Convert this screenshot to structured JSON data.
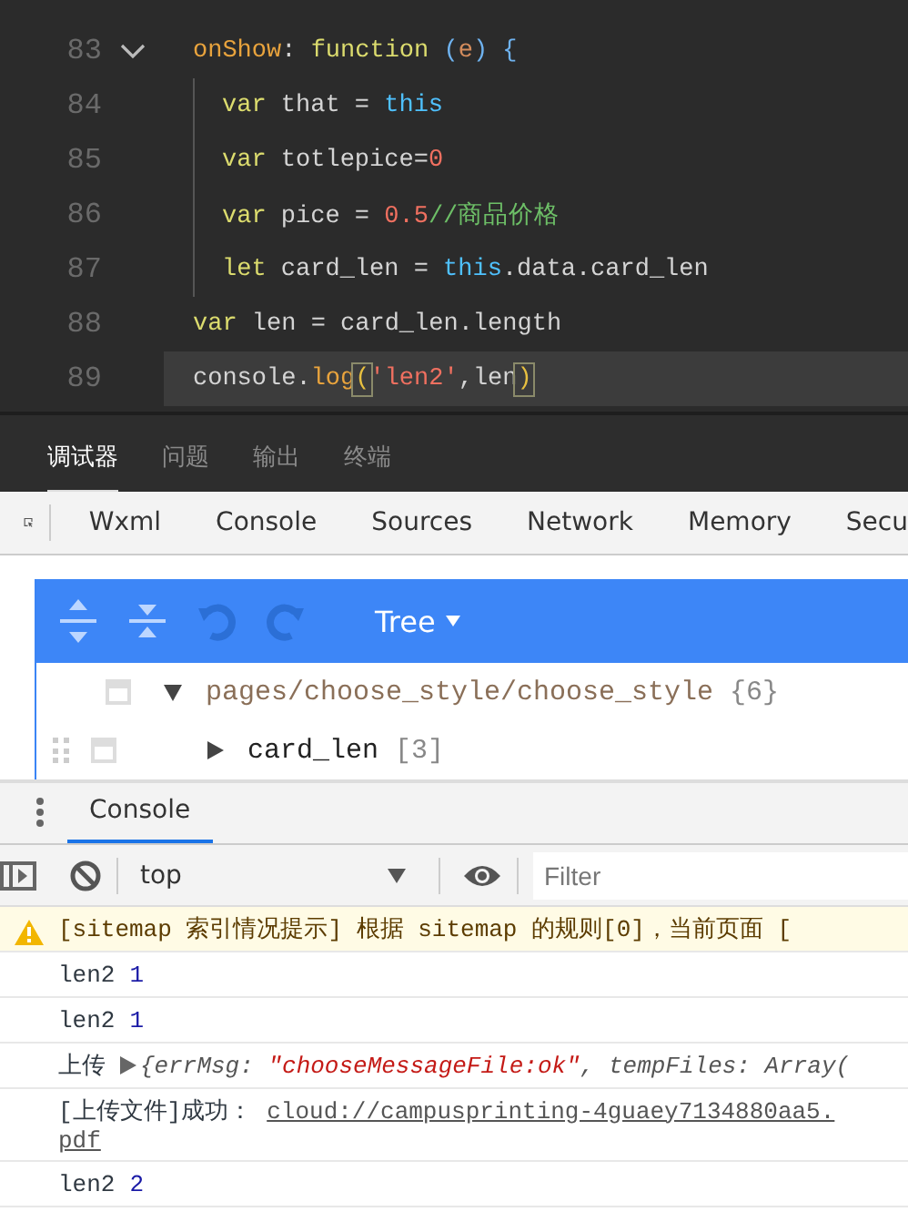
{
  "editor": {
    "lines": [
      {
        "number": "83",
        "foldable": true,
        "current": false,
        "guide": false,
        "tokens": [
          {
            "text": "onShow",
            "kind": "prop"
          },
          {
            "text": ": ",
            "kind": "plain"
          },
          {
            "text": "function",
            "kind": "keyword"
          },
          {
            "text": " (",
            "kind": "paren"
          },
          {
            "text": "e",
            "kind": "param"
          },
          {
            "text": ")",
            "kind": "paren"
          },
          {
            "text": " {",
            "kind": "paren"
          }
        ]
      },
      {
        "number": "84",
        "foldable": false,
        "current": false,
        "guide": true,
        "tokens": [
          {
            "text": "var",
            "kind": "keyword"
          },
          {
            "text": " that = ",
            "kind": "plain"
          },
          {
            "text": "this",
            "kind": "this"
          }
        ]
      },
      {
        "number": "85",
        "foldable": false,
        "current": false,
        "guide": true,
        "tokens": [
          {
            "text": "var",
            "kind": "keyword"
          },
          {
            "text": " totlepice=",
            "kind": "plain"
          },
          {
            "text": "0",
            "kind": "number"
          }
        ]
      },
      {
        "number": "86",
        "foldable": false,
        "current": false,
        "guide": true,
        "tokens": [
          {
            "text": "var",
            "kind": "keyword"
          },
          {
            "text": " pice = ",
            "kind": "plain"
          },
          {
            "text": "0.5",
            "kind": "number"
          },
          {
            "text": "//商品价格",
            "kind": "comment"
          }
        ]
      },
      {
        "number": "87",
        "foldable": false,
        "current": false,
        "guide": true,
        "tokens": [
          {
            "text": "let",
            "kind": "keyword"
          },
          {
            "text": " card_len = ",
            "kind": "plain"
          },
          {
            "text": "this",
            "kind": "this"
          },
          {
            "text": ".data.card_len",
            "kind": "plain"
          }
        ]
      },
      {
        "number": "88",
        "foldable": false,
        "current": false,
        "guide": false,
        "tokens": [
          {
            "text": "var",
            "kind": "keyword"
          },
          {
            "text": " len = card_len.length",
            "kind": "plain"
          }
        ]
      },
      {
        "number": "89",
        "foldable": false,
        "current": true,
        "guide": false,
        "tokens": [
          {
            "text": "console.",
            "kind": "plain"
          },
          {
            "text": "log",
            "kind": "prop"
          },
          {
            "text": "(",
            "kind": "match"
          },
          {
            "text": "'len2'",
            "kind": "number"
          },
          {
            "text": ",len",
            "kind": "plain"
          },
          {
            "text": ")",
            "kind": "match"
          }
        ]
      }
    ]
  },
  "bottom_tabs": [
    {
      "label": "调试器",
      "selected": true
    },
    {
      "label": "问题",
      "selected": false
    },
    {
      "label": "输出",
      "selected": false
    },
    {
      "label": "终端",
      "selected": false
    }
  ],
  "devtools_tabs": [
    "Wxml",
    "Console",
    "Sources",
    "Network",
    "Memory",
    "Secu"
  ],
  "appdata": {
    "mode": "Tree",
    "tree": [
      {
        "key": "pages/choose_style/choose_style",
        "count": "{6}",
        "expanded": true,
        "children": [
          {
            "key": "card_len",
            "count": "[3]",
            "expanded": false
          }
        ]
      }
    ]
  },
  "console": {
    "tab": "Console",
    "context": "top",
    "filter": {
      "placeholder": "Filter"
    },
    "messages": [
      {
        "kind": "warning",
        "parts": [
          {
            "text": "[sitemap 索引情况提示] 根据 sitemap 的规则[0]，当前页面 [",
            "kind": "plain"
          }
        ]
      },
      {
        "kind": "log",
        "parts": [
          {
            "text": "len2",
            "kind": "plain"
          },
          {
            "text": "1",
            "kind": "number"
          }
        ]
      },
      {
        "kind": "log",
        "parts": [
          {
            "text": "len2",
            "kind": "plain"
          },
          {
            "text": "1",
            "kind": "number"
          }
        ]
      },
      {
        "kind": "object",
        "parts": [
          {
            "text": "上传",
            "kind": "plain"
          },
          {
            "text": "{errMsg: ",
            "kind": "key"
          },
          {
            "text": "\"chooseMessageFile:ok\"",
            "kind": "string"
          },
          {
            "text": ", tempFiles: Array(",
            "kind": "key"
          }
        ]
      },
      {
        "kind": "link",
        "parts": [
          {
            "text": "[上传文件]成功：",
            "kind": "plain"
          },
          {
            "text": "cloud://campusprinting-4guaey7134880aa5.",
            "kind": "link"
          },
          {
            "text": "pdf",
            "kind": "link"
          }
        ]
      },
      {
        "kind": "log",
        "parts": [
          {
            "text": "len2",
            "kind": "plain"
          },
          {
            "text": "2",
            "kind": "number"
          }
        ]
      }
    ]
  }
}
